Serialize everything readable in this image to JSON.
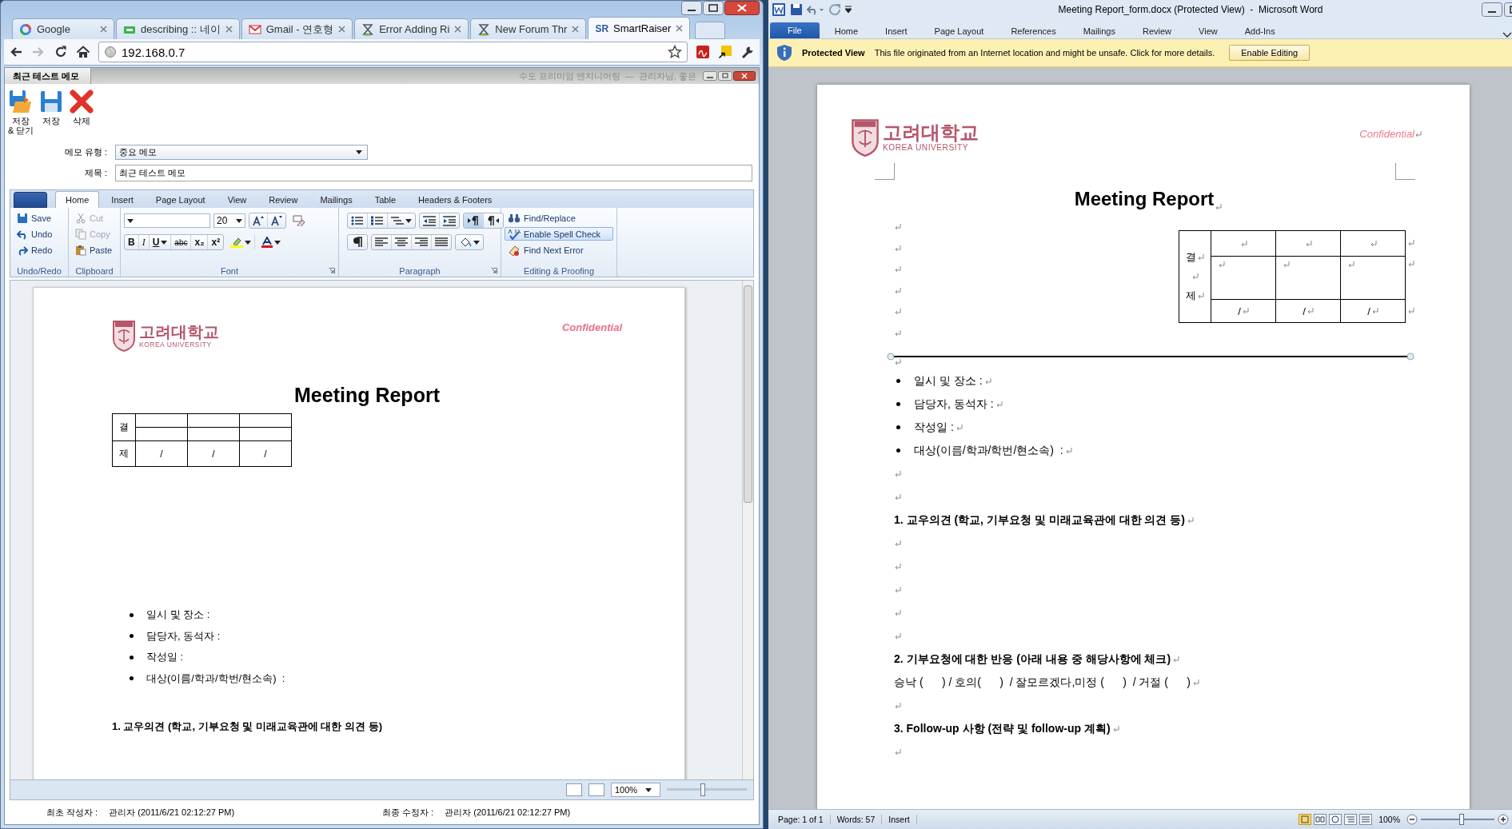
{
  "browser": {
    "tabs": [
      {
        "label": "Google",
        "kind": "google",
        "selected": false
      },
      {
        "label": "describing :: 네이",
        "kind": "page",
        "selected": false
      },
      {
        "label": "Gmail - 연호형",
        "kind": "mail",
        "selected": false
      },
      {
        "label": "Error Adding Ri",
        "kind": "forum",
        "selected": false
      },
      {
        "label": "New Forum Thr",
        "kind": "forum",
        "selected": false
      },
      {
        "label": "SmartRaiser",
        "kind": "sr",
        "icon_text": "SR",
        "selected": true
      }
    ],
    "address": "192.168.0.7"
  },
  "memo": {
    "title": "최근 테스트 메모",
    "header_info": "수도 프리미엄 엔지니어링  —  관리자님, 좋은",
    "actions": [
      {
        "label": "저장\n& 닫기",
        "kind": "save-close"
      },
      {
        "label": "저장",
        "kind": "save"
      },
      {
        "label": "삭제",
        "kind": "delete"
      }
    ],
    "fields": [
      {
        "label": "메모 유형 :",
        "value": "중요 메모",
        "kind": "select"
      },
      {
        "label": "제목 :",
        "value": "최근 테스트 메모",
        "kind": "text"
      }
    ],
    "ribbon": {
      "tabs": [
        {
          "label": "Home",
          "selected": true
        },
        {
          "label": "Insert",
          "selected": false
        },
        {
          "label": "Page Layout",
          "selected": false
        },
        {
          "label": "View",
          "selected": false
        },
        {
          "label": "Review",
          "selected": false
        },
        {
          "label": "Mailings",
          "selected": false
        },
        {
          "label": "Table",
          "selected": false
        },
        {
          "label": "Headers & Footers",
          "selected": false
        }
      ],
      "undo": {
        "label": "Undo/Redo",
        "items": [
          {
            "label": "Save",
            "kind": "save"
          },
          {
            "label": "Undo",
            "kind": "undo"
          },
          {
            "label": "Redo",
            "kind": "redo"
          }
        ]
      },
      "clipboard": {
        "label": "Clipboard",
        "items": [
          {
            "label": "Cut",
            "kind": "cut",
            "disabled": true
          },
          {
            "label": "Copy",
            "kind": "copy",
            "disabled": true
          },
          {
            "label": "Paste",
            "kind": "paste",
            "disabled": false
          }
        ]
      },
      "font": {
        "label": "Font",
        "font_size": "20",
        "format_buttons": [
          {
            "label": "B",
            "kind": "bold"
          },
          {
            "label": "I",
            "kind": "italic"
          },
          {
            "label": "U",
            "kind": "underline"
          },
          {
            "label": "abc",
            "kind": "strike"
          },
          {
            "label": "x₂",
            "kind": "sub"
          },
          {
            "label": "x²",
            "kind": "sup"
          }
        ]
      },
      "paragraph": {
        "label": "Paragraph",
        "buttons": [
          {
            "kind": "bullets",
            "pressed": false
          },
          {
            "kind": "numbering",
            "pressed": false
          },
          {
            "kind": "multilevel",
            "pressed": false
          },
          {
            "kind": "outdent",
            "pressed": false
          },
          {
            "kind": "indent",
            "pressed": false
          },
          {
            "kind": "ltr",
            "pressed": true
          },
          {
            "kind": "rtl",
            "pressed": false
          },
          {
            "kind": "marks",
            "pressed": false
          },
          {
            "kind": "left",
            "pressed": false
          },
          {
            "kind": "center",
            "pressed": false
          },
          {
            "kind": "right",
            "pressed": false
          },
          {
            "kind": "justify",
            "pressed": false
          },
          {
            "kind": "shading",
            "pressed": false
          }
        ]
      },
      "editing": {
        "label": "Editing & Proofing",
        "items": [
          {
            "label": "Find/Replace",
            "kind": "find",
            "selected": false
          },
          {
            "label": "Enable Spell Check",
            "kind": "spell",
            "selected": true
          },
          {
            "label": "Find Next Error",
            "kind": "next-error",
            "selected": false
          }
        ]
      }
    },
    "document": {
      "logo_name": "고려대학교",
      "logo_sub": "KOREA UNIVERSITY",
      "confidential": "Confidential",
      "title": "Meeting Report",
      "approval": {
        "top_label": "결",
        "bottom_label": "제",
        "cells": [
          "/",
          "/",
          "/"
        ]
      },
      "bullets": [
        "일시 및 장소 :",
        "담당자, 동석자 :",
        "작성일 :",
        "대상(이름/학과/학번/현소속)  :"
      ],
      "heading": "1. 교우의견 (학교, 기부요청 및 미래교육관에 대한 의견 등)"
    },
    "zoom": {
      "label": "100%",
      "level": 0.45
    },
    "footer": [
      {
        "label": "최초 작성자 :",
        "value": "관리자 (2011/6/21 02:12:27 PM)"
      },
      {
        "label": "최종 수정자 :",
        "value": "관리자 (2011/6/21 02:12:27 PM)"
      }
    ]
  },
  "word": {
    "title": "Meeting Report_form.docx (Protected View)  -  Microsoft Word",
    "tabs": [
      {
        "label": "File",
        "kind": "file"
      },
      {
        "label": "Home",
        "kind": "tab"
      },
      {
        "label": "Insert",
        "kind": "tab"
      },
      {
        "label": "Page Layout",
        "kind": "tab"
      },
      {
        "label": "References",
        "kind": "tab"
      },
      {
        "label": "Mailings",
        "kind": "tab"
      },
      {
        "label": "Review",
        "kind": "tab"
      },
      {
        "label": "View",
        "kind": "tab"
      },
      {
        "label": "Add-Ins",
        "kind": "tab"
      }
    ],
    "protected": {
      "label": "Protected View",
      "message": "This file originated from an Internet location and might be unsafe. Click for more details.",
      "button": "Enable Editing"
    },
    "document": {
      "formatting_marks": true,
      "logo_name": "고려대학교",
      "logo_sub": "KOREA UNIVERSITY",
      "confidential": "Confidential",
      "title": "Meeting Report",
      "approval": {
        "top_label": "결",
        "bottom_label": "제",
        "cells": [
          "/",
          "/",
          "/"
        ]
      },
      "top_paragraphs": [
        {
          "kind": "empty"
        },
        {
          "kind": "empty"
        },
        {
          "kind": "empty"
        },
        {
          "kind": "empty"
        },
        {
          "kind": "empty"
        },
        {
          "kind": "empty"
        }
      ],
      "paragraphs": [
        {
          "kind": "empty"
        },
        {
          "kind": "bullet",
          "text": "일시 및 장소 :"
        },
        {
          "kind": "bullet",
          "text": "담당자, 동석자 :"
        },
        {
          "kind": "bullet",
          "text": "작성일 :"
        },
        {
          "kind": "bullet",
          "text": "대상(이름/학과/학번/현소속)  :"
        },
        {
          "kind": "empty"
        },
        {
          "kind": "empty"
        },
        {
          "kind": "heading",
          "text": "1. 교우의견 (학교, 기부요청 및 미래교육관에 대한 의견 등)"
        },
        {
          "kind": "empty"
        },
        {
          "kind": "empty"
        },
        {
          "kind": "empty"
        },
        {
          "kind": "empty"
        },
        {
          "kind": "empty"
        },
        {
          "kind": "heading",
          "text": "2. 기부요청에 대한 반응 (아래 내용 중 해당사항에 체크)"
        },
        {
          "kind": "text",
          "text": "승낙 (      ) / 호의(      )  / 잘모르겠다,미정 (      )  / 거절 (      )"
        },
        {
          "kind": "empty"
        },
        {
          "kind": "heading",
          "text": "3. Follow-up 사항 (전략 및 follow-up 계획)"
        },
        {
          "kind": "empty"
        }
      ]
    },
    "status": [
      "Page: 1 of 1",
      "Words: 57",
      "Insert"
    ],
    "view_buttons": [
      {
        "kind": "print",
        "selected": true
      },
      {
        "kind": "reading",
        "selected": false
      },
      {
        "kind": "web",
        "selected": false
      },
      {
        "kind": "outline",
        "selected": false
      },
      {
        "kind": "draft",
        "selected": false
      }
    ],
    "zoom": {
      "label": "100%",
      "level": 0.55
    }
  }
}
